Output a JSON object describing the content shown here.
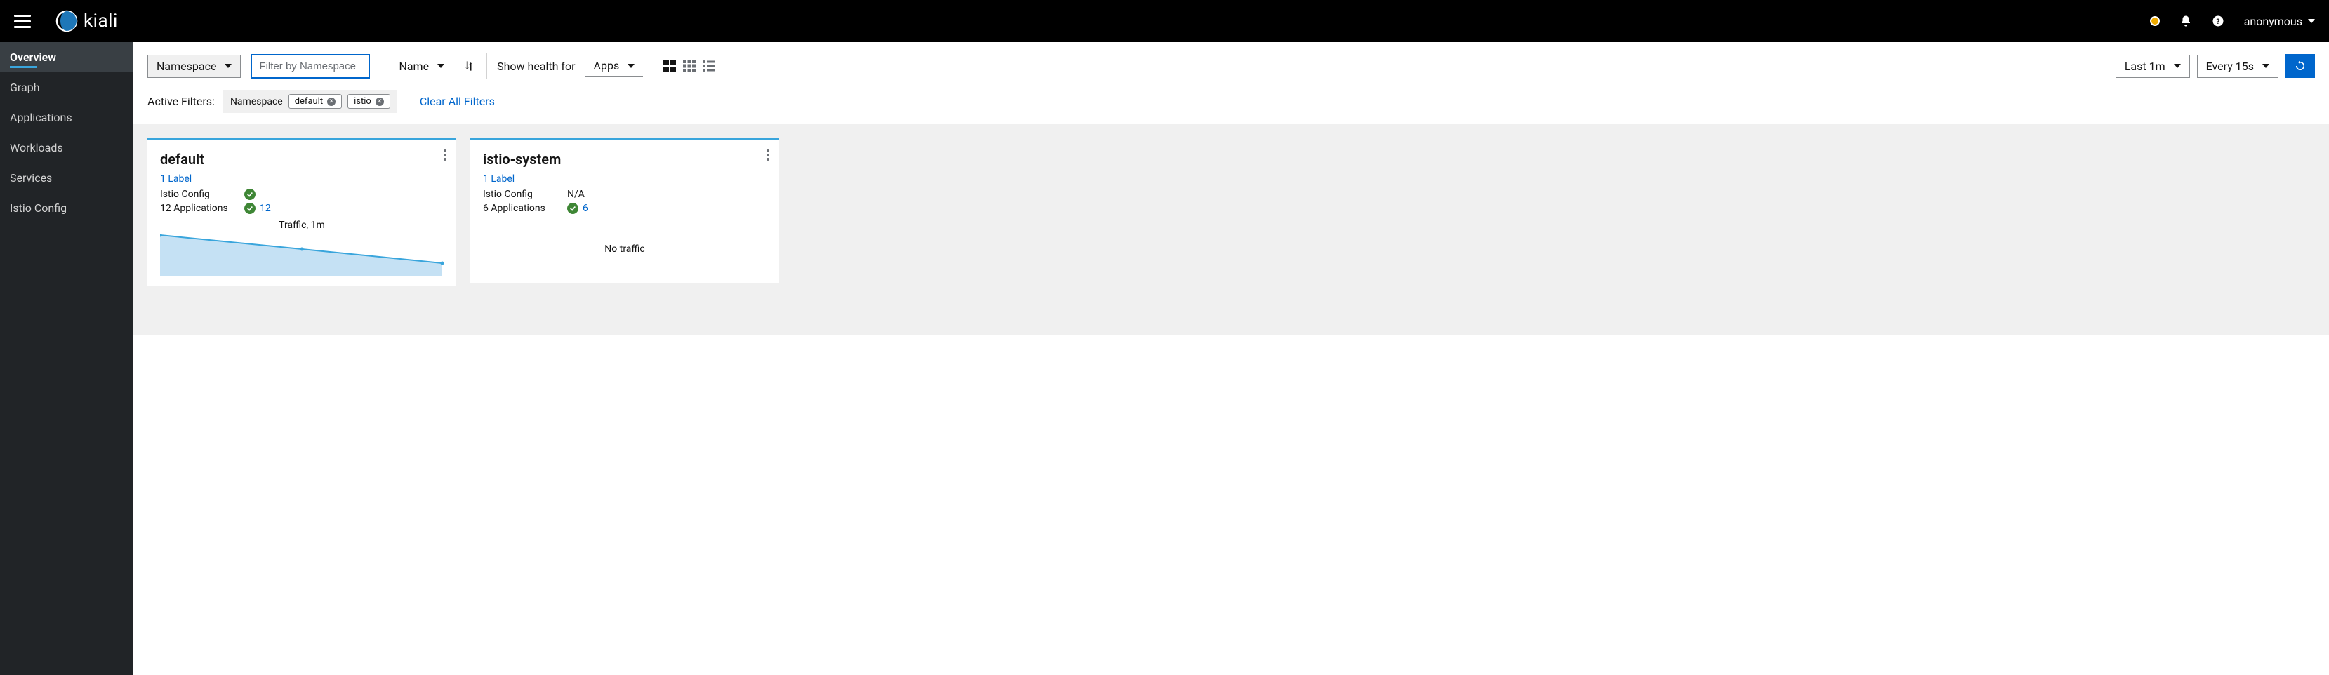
{
  "header": {
    "brand": "kiali",
    "user": "anonymous"
  },
  "sidebar": {
    "items": [
      {
        "label": "Overview",
        "active": true
      },
      {
        "label": "Graph"
      },
      {
        "label": "Applications"
      },
      {
        "label": "Workloads"
      },
      {
        "label": "Services"
      },
      {
        "label": "Istio Config"
      }
    ]
  },
  "toolbar": {
    "filter_type": "Namespace",
    "filter_placeholder": "Filter by Namespace",
    "sort_by": "Name",
    "health_label": "Show health for",
    "health_for": "Apps",
    "time_range": "Last 1m",
    "refresh_interval": "Every 15s"
  },
  "filters": {
    "label": "Active Filters:",
    "group_label": "Namespace",
    "chips": [
      "default",
      "istio"
    ],
    "clear_label": "Clear All Filters"
  },
  "cards": [
    {
      "title": "default",
      "labels_link": "1 Label",
      "istio_config_label": "Istio Config",
      "istio_config_value": "ok",
      "apps_label": "12 Applications",
      "apps_count": "12",
      "traffic_label": "Traffic, 1m",
      "has_traffic": true
    },
    {
      "title": "istio-system",
      "labels_link": "1 Label",
      "istio_config_label": "Istio Config",
      "istio_config_value": "N/A",
      "apps_label": "6 Applications",
      "apps_count": "6",
      "no_traffic_label": "No traffic",
      "has_traffic": false
    }
  ],
  "chart_data": {
    "type": "area",
    "title": "Traffic, 1m",
    "x": [
      0,
      0.5,
      1
    ],
    "values": [
      58,
      40,
      20
    ],
    "ylim": [
      0,
      60
    ],
    "xlabel": "",
    "ylabel": ""
  }
}
